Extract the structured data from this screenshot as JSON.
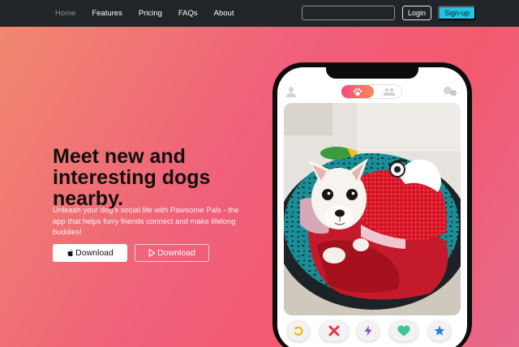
{
  "nav": {
    "links": [
      "Home",
      "Features",
      "Pricing",
      "FAQs",
      "About"
    ],
    "active": "Home",
    "search_placeholder": "",
    "login_label": "Login",
    "signup_label": "Sign-up"
  },
  "hero": {
    "title": "Meet new and interesting dogs nearby.",
    "subtitle": "Unleash your dog's social life with Pawsome Pals - the app that helps furry friends connect and make lifelong buddies!",
    "download_apple_label": "Download",
    "download_play_label": "Download"
  },
  "phone": {
    "toggle_active": "paw-icon",
    "toggle_inactive": "users-icon",
    "action_icons": [
      "undo-icon",
      "close-icon",
      "bolt-icon",
      "heart-icon",
      "star-icon"
    ]
  },
  "colors": {
    "navbar": "#212529",
    "signup": "#22c4e6",
    "gradient_start": "#f08a6e",
    "gradient_end": "#f2596e",
    "undo": "#f0b400",
    "close": "#e8354a",
    "bolt": "#8a4ad6",
    "heart": "#3cc49a",
    "star": "#2a86d6"
  }
}
